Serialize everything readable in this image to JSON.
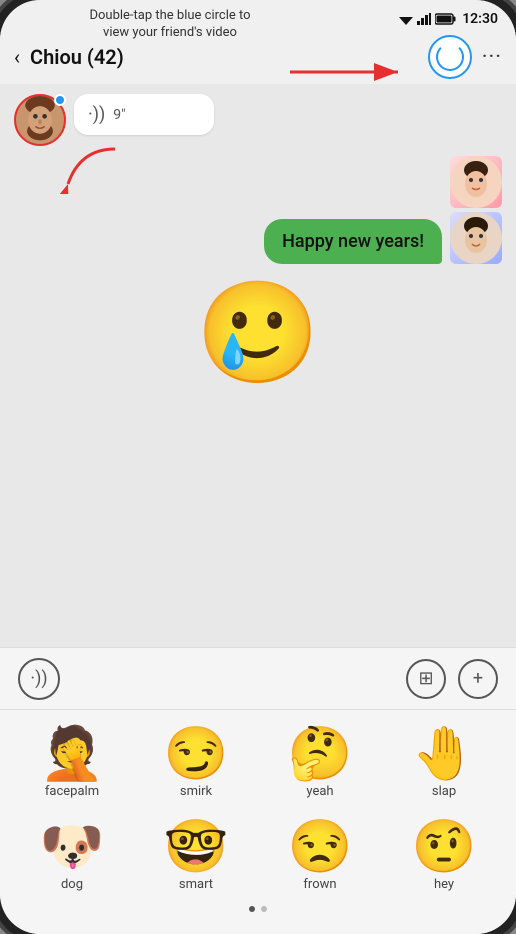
{
  "statusBar": {
    "time": "12:30"
  },
  "tooltip": {
    "text": "Double-tap the blue circle to view your friend's video"
  },
  "navBar": {
    "backLabel": "‹",
    "title": "Chiou (42)",
    "moreLabel": "···"
  },
  "voiceMessage": {
    "duration": "9\""
  },
  "outgoingMessage": {
    "text": "Happy new years!"
  },
  "bigEmoji": {
    "char": "🥲"
  },
  "inputBar": {
    "voiceLabel": "·))",
    "keyboardLabel": "⊞",
    "addLabel": "+"
  },
  "emojiKeyboard": {
    "items": [
      {
        "id": "facepalm",
        "emoji": "🤦",
        "label": "facepalm"
      },
      {
        "id": "smirk",
        "emoji": "😏",
        "label": "smirk"
      },
      {
        "id": "yeah",
        "emoji": "🤔",
        "label": "yeah"
      },
      {
        "id": "slap",
        "emoji": "🤚",
        "label": "slap"
      },
      {
        "id": "dog",
        "emoji": "🐶",
        "label": "dog"
      },
      {
        "id": "smart",
        "emoji": "🤓",
        "label": "smart"
      },
      {
        "id": "frown",
        "emoji": "😒",
        "label": "frown"
      },
      {
        "id": "hey",
        "emoji": "🤨",
        "label": "hey"
      }
    ]
  },
  "pageDots": [
    true,
    false
  ]
}
